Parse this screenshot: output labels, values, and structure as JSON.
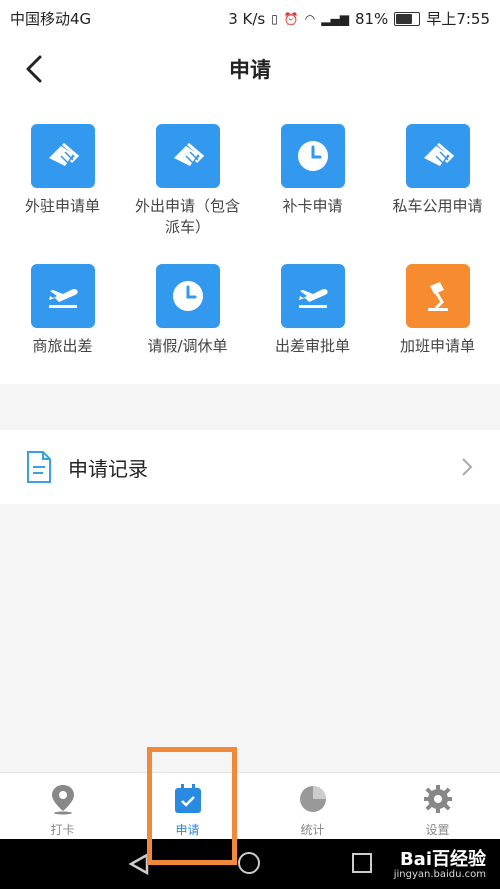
{
  "status_bar": {
    "carrier": "中国移动4G",
    "speed": "3 K/s",
    "battery": "81%",
    "time": "早上7:55"
  },
  "header": {
    "title": "申请"
  },
  "grid": [
    {
      "label": "外驻申请单",
      "icon": "handshake-icon",
      "color": "#3399ee"
    },
    {
      "label": "外出申请（包含派车）",
      "icon": "handshake-icon",
      "color": "#3399ee"
    },
    {
      "label": "补卡申请",
      "icon": "clock-icon",
      "color": "#3399ee"
    },
    {
      "label": "私车公用申请",
      "icon": "handshake-icon",
      "color": "#3399ee"
    },
    {
      "label": "商旅出差",
      "icon": "plane-icon",
      "color": "#3399ee"
    },
    {
      "label": "请假/调休单",
      "icon": "clock-icon",
      "color": "#3399ee"
    },
    {
      "label": "出差审批单",
      "icon": "plane-icon",
      "color": "#3399ee"
    },
    {
      "label": "加班申请单",
      "icon": "lamp-icon",
      "color": "#f68b2f"
    }
  ],
  "record": {
    "label": "申请记录",
    "icon": "document-icon"
  },
  "tabs": [
    {
      "label": "打卡",
      "icon": "location-icon",
      "active": false
    },
    {
      "label": "申请",
      "icon": "calendar-check-icon",
      "active": true
    },
    {
      "label": "统计",
      "icon": "pie-chart-icon",
      "active": false
    },
    {
      "label": "设置",
      "icon": "gear-icon",
      "active": false
    }
  ],
  "watermark": {
    "text": "Bai百经验",
    "sub": "jingyan.baidu.com"
  }
}
